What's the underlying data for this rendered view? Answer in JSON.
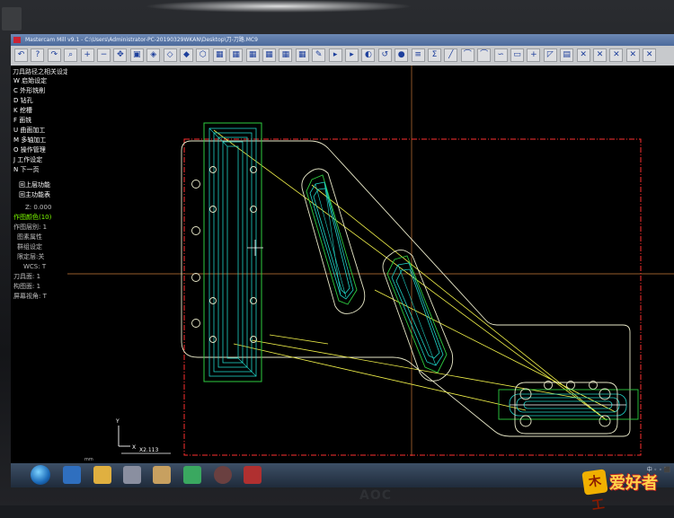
{
  "window": {
    "title": "Mastercam Mill v9.1 - C:\\Users\\Administrator-PC-20190329WKAN\\Desktop\\刀-刀路.MC9"
  },
  "toolbar": {
    "icons": [
      "undo-icon",
      "help-icon",
      "redo-icon",
      "zoom-icon",
      "zoom-in-icon",
      "zoom-out-icon",
      "pan-icon",
      "fit-icon",
      "gview-top-icon",
      "gview-front-icon",
      "gview-side-icon",
      "gview-iso-icon",
      "cube-icon",
      "cube-icon",
      "cube-icon",
      "cube-icon",
      "cube-icon",
      "cube-icon",
      "pencil-icon",
      "select-icon",
      "select-icon",
      "shade-icon",
      "rotate-icon",
      "ball-icon",
      "layers-icon",
      "sigma-icon",
      "line-icon",
      "arc-icon",
      "arc-icon",
      "curve-icon",
      "rectangle-icon",
      "point-icon",
      "chamfer-icon",
      "save-icon",
      "trim-icon",
      "trim-icon",
      "trim-icon",
      "trim-icon",
      "trim-icon"
    ]
  },
  "menu": {
    "header": "刀具路径之相关设定:",
    "items": [
      {
        "label": "W 启始设定"
      },
      {
        "label": "C 外形铣削"
      },
      {
        "label": "D 钻孔"
      },
      {
        "label": "K 挖槽"
      },
      {
        "label": "F 面铣"
      },
      {
        "label": "U 曲面加工"
      },
      {
        "label": "M 多轴加工"
      },
      {
        "label": "O 操作管理"
      },
      {
        "label": "J 工作设定"
      },
      {
        "label": "N 下一页"
      }
    ],
    "nav": [
      {
        "label": "回上层功能"
      },
      {
        "label": "回主功能表"
      }
    ],
    "status": {
      "z": "Z: 0.000",
      "color": "作图颜色(10)",
      "layer": "作图层别: 1",
      "attr": "图素属性",
      "group": "群组设定",
      "mask": "限定层:关",
      "wcs": "WCS: T",
      "tplane": "刀具面: 1",
      "cplane": "构图面: 1",
      "gview": "屏幕视角: T"
    }
  },
  "canvas": {
    "axis_label_y": "Y",
    "axis_label_x": "X",
    "unit_label": "mm",
    "scale_readout": "X2.113"
  },
  "taskbar": {
    "tray_text": "中 ◦ ◦ ⬛"
  },
  "brand": {
    "mark": "木工",
    "text": "爱好者"
  },
  "monitor": {
    "logo": "AOC"
  },
  "colors": {
    "toolpath": "#1fd3c6",
    "geometry_green": "#2ecc40",
    "part_outline": "#e8e8c8",
    "stock_boundary": "#ff3030",
    "rapid_moves": "#f2f24a",
    "crosshair": "#d08040"
  }
}
